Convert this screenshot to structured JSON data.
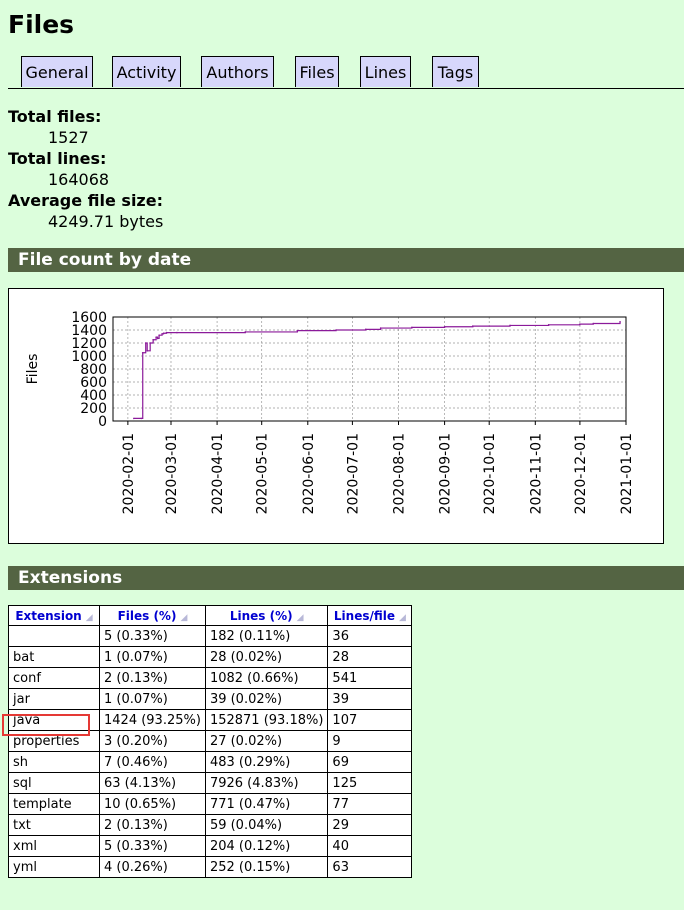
{
  "page_title": "Files",
  "tabs": [
    {
      "label": "General"
    },
    {
      "label": "Activity"
    },
    {
      "label": "Authors"
    },
    {
      "label": "Files"
    },
    {
      "label": "Lines"
    },
    {
      "label": "Tags"
    }
  ],
  "stats": {
    "total_files_label": "Total files:",
    "total_files_value": "1527",
    "total_lines_label": "Total lines:",
    "total_lines_value": "164068",
    "avg_size_label": "Average file size:",
    "avg_size_value": "4249.71 bytes"
  },
  "sections": {
    "file_count_title": "File count by date",
    "extensions_title": "Extensions"
  },
  "chart_data": {
    "type": "line",
    "title": "",
    "xlabel": "",
    "ylabel": "Files",
    "ylim": [
      0,
      1600
    ],
    "yticks": [
      0,
      200,
      400,
      600,
      800,
      1000,
      1200,
      1400,
      1600
    ],
    "xlim": [
      "2020-01-22",
      "2021-01-01"
    ],
    "xticks": [
      "2020-02-01",
      "2020-03-01",
      "2020-04-01",
      "2020-05-01",
      "2020-06-01",
      "2020-07-01",
      "2020-08-01",
      "2020-09-01",
      "2020-10-01",
      "2020-11-01",
      "2020-12-01",
      "2021-01-01"
    ],
    "grid": true,
    "line_color": "#8b1a9a",
    "x": [
      "2020-02-05",
      "2020-02-10",
      "2020-02-11",
      "2020-02-13",
      "2020-02-14",
      "2020-02-16",
      "2020-02-18",
      "2020-02-20",
      "2020-02-21",
      "2020-02-22",
      "2020-02-24",
      "2020-02-25",
      "2020-02-27",
      "2020-03-05",
      "2020-04-20",
      "2020-05-25",
      "2020-06-20",
      "2020-07-10",
      "2020-07-20",
      "2020-08-10",
      "2020-09-01",
      "2020-09-20",
      "2020-10-15",
      "2020-11-10",
      "2020-12-01",
      "2020-12-10",
      "2020-12-28"
    ],
    "y": [
      40,
      40,
      1050,
      1200,
      1080,
      1200,
      1250,
      1290,
      1270,
      1320,
      1340,
      1350,
      1360,
      1360,
      1370,
      1390,
      1400,
      1410,
      1430,
      1440,
      1450,
      1460,
      1470,
      1480,
      1490,
      1500,
      1527
    ]
  },
  "extensions_table": {
    "headers": [
      "Extension",
      "Files (%)",
      "Lines (%)",
      "Lines/file"
    ],
    "rows": [
      [
        "",
        "5 (0.33%)",
        "182 (0.11%)",
        "36"
      ],
      [
        "bat",
        "1 (0.07%)",
        "28 (0.02%)",
        "28"
      ],
      [
        "conf",
        "2 (0.13%)",
        "1082 (0.66%)",
        "541"
      ],
      [
        "jar",
        "1 (0.07%)",
        "39 (0.02%)",
        "39"
      ],
      [
        "java",
        "1424 (93.25%)",
        "152871 (93.18%)",
        "107"
      ],
      [
        "properties",
        "3 (0.20%)",
        "27 (0.02%)",
        "9"
      ],
      [
        "sh",
        "7 (0.46%)",
        "483 (0.29%)",
        "69"
      ],
      [
        "sql",
        "63 (4.13%)",
        "7926 (4.83%)",
        "125"
      ],
      [
        "template",
        "10 (0.65%)",
        "771 (0.47%)",
        "77"
      ],
      [
        "txt",
        "2 (0.13%)",
        "59 (0.04%)",
        "29"
      ],
      [
        "xml",
        "5 (0.33%)",
        "204 (0.12%)",
        "40"
      ],
      [
        "yml",
        "4 (0.26%)",
        "252 (0.15%)",
        "63"
      ]
    ],
    "highlight_color": "#e53935"
  }
}
